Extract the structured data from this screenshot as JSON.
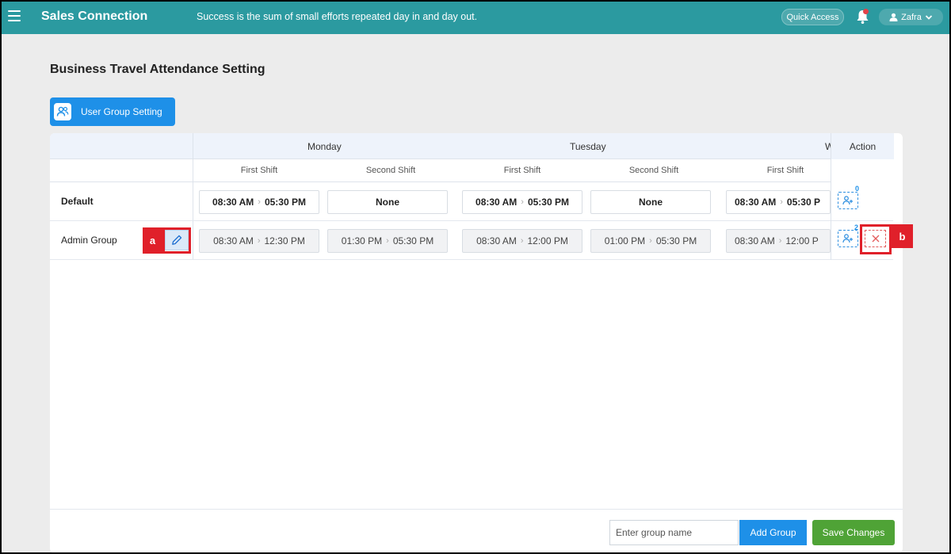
{
  "topbar": {
    "app_title": "Sales Connection",
    "tagline": "Success is the sum of small efforts repeated day in and day out.",
    "quick_access": "Quick Access",
    "user_name": "Zafra",
    "icons": [
      "menu-icon",
      "bell-icon",
      "user-icon",
      "chevron-down-icon"
    ],
    "color": "#2b9aa0"
  },
  "page": {
    "title": "Business Travel Attendance Setting",
    "user_group_setting": "User Group Setting"
  },
  "table": {
    "days": [
      "Monday",
      "Tuesday",
      "W"
    ],
    "action_header": "Action",
    "shift_headers": [
      "First Shift",
      "Second Shift",
      "First Shift",
      "Second Shift",
      "First Shift"
    ],
    "rows": [
      {
        "name": "Default",
        "user_count": "0",
        "shifts": [
          {
            "start": "08:30 AM",
            "end": "05:30 PM"
          },
          {
            "text": "None"
          },
          {
            "start": "08:30 AM",
            "end": "05:30 PM"
          },
          {
            "text": "None"
          },
          {
            "start": "08:30 AM",
            "end": "05:30 P"
          }
        ]
      },
      {
        "name": "Admin Group",
        "user_count": "2",
        "shifts": [
          {
            "start": "08:30 AM",
            "end": "12:30 PM"
          },
          {
            "start": "01:30 PM",
            "end": "05:30 PM"
          },
          {
            "start": "08:30 AM",
            "end": "12:00 PM"
          },
          {
            "start": "01:00 PM",
            "end": "05:30 PM"
          },
          {
            "start": "08:30 AM",
            "end": "12:00 P"
          }
        ]
      }
    ]
  },
  "callouts": {
    "a": "a",
    "b": "b"
  },
  "footer": {
    "group_name_placeholder": "Enter group name",
    "add_group": "Add Group",
    "save_changes": "Save Changes"
  }
}
